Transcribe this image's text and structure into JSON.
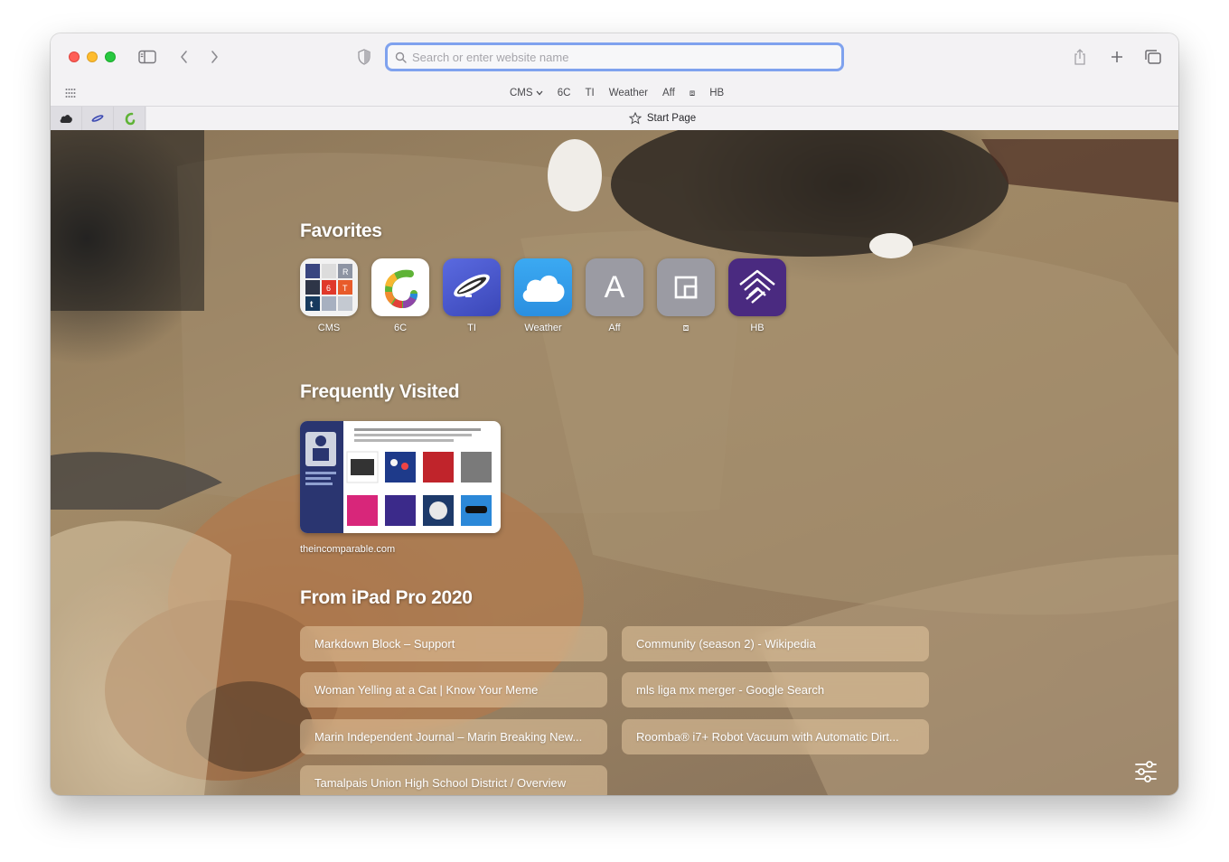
{
  "toolbar": {
    "address_placeholder": "Search or enter website name"
  },
  "favorites_bar": {
    "items": [
      "CMS",
      "6C",
      "TI",
      "Weather",
      "Aff",
      "⧈",
      "HB"
    ]
  },
  "tab_bar": {
    "active_tab_title": "Start Page"
  },
  "start_page": {
    "favorites_title": "Favorites",
    "favorites": [
      {
        "label": "CMS",
        "icon": "cms-grid-icon"
      },
      {
        "label": "6C",
        "icon": "six-colors-icon"
      },
      {
        "label": "TI",
        "icon": "blimp-icon"
      },
      {
        "label": "Weather",
        "icon": "cloud-icon"
      },
      {
        "label": "Aff",
        "icon": "letter-a-icon"
      },
      {
        "label": "⧈",
        "icon": "square-icon"
      },
      {
        "label": "HB",
        "icon": "homebridge-icon"
      }
    ],
    "frequently_visited_title": "Frequently Visited",
    "frequently_visited": [
      {
        "label": "theincomparable.com"
      }
    ],
    "icloud_tabs_title": "From iPad Pro 2020",
    "icloud_tabs": [
      "Markdown Block – Support",
      "Community (season 2) - Wikipedia",
      "Woman Yelling at a Cat | Know Your Meme",
      "mls liga mx merger - Google Search",
      "Marin Independent Journal – Marin Breaking New...",
      "Roomba® i7+ Robot Vacuum with Automatic Dirt...",
      "Tamalpais Union High School District / Overview"
    ]
  }
}
